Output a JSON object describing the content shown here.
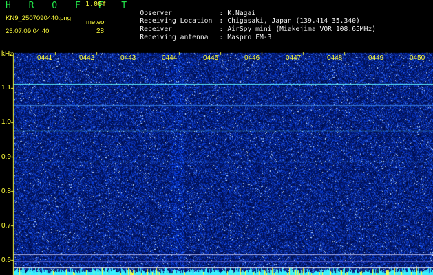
{
  "header": {
    "brand": "H R O F F T",
    "version": "1.00f",
    "filename": "KN9_2507090440.png",
    "meteor_label": "meteor",
    "datetime": "25.07.09 04:40",
    "meteor_count": "28"
  },
  "info": [
    {
      "key": "Observer",
      "value": "K.Nagai"
    },
    {
      "key": "Receiving Location",
      "value": "Chigasaki, Japan (139.414 35.340)"
    },
    {
      "key": "Receiver",
      "value": "AirSpy mini (Miakejima VOR 108.65MHz)"
    },
    {
      "key": "Receiving antenna",
      "value": "Maspro FM-3"
    }
  ],
  "separator": ":",
  "spectrogram": {
    "y_unit": "kHz",
    "y_ticks": [
      "1.1",
      "1.0",
      "0.9",
      "0.8",
      "0.7",
      "0.6"
    ],
    "x_ticks": [
      "0441",
      "0442",
      "0443",
      "0444",
      "0445",
      "0446",
      "0447",
      "0448",
      "0449",
      "0450"
    ],
    "colors": {
      "background": "#000000",
      "noise": "#1a2ccf",
      "label": "#ffff3c",
      "brand": "#22e64a"
    }
  }
}
